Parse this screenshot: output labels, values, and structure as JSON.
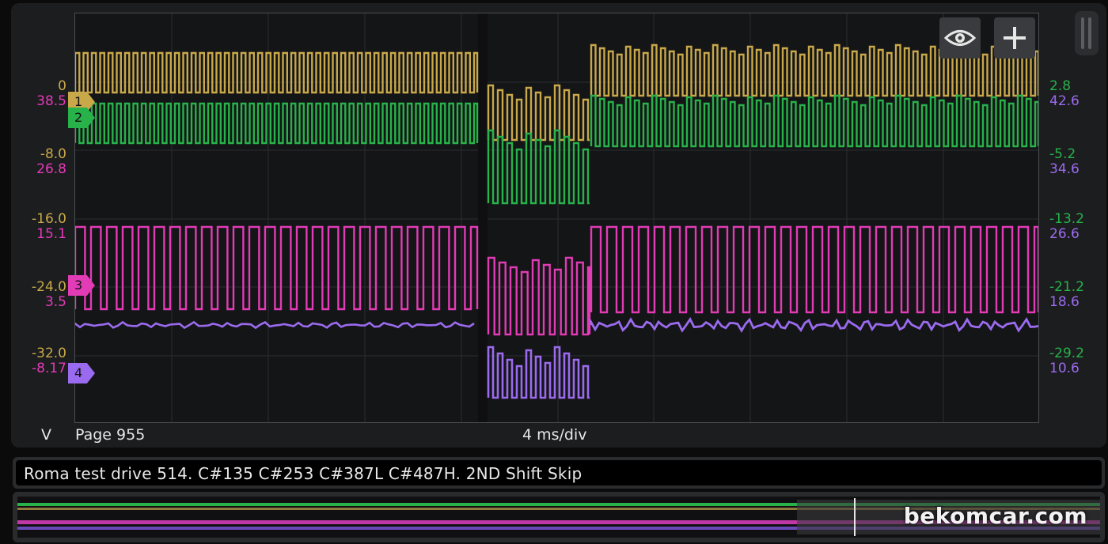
{
  "scope": {
    "channels": [
      {
        "id": "1",
        "color": "#c9a84a"
      },
      {
        "id": "2",
        "color": "#27b24a"
      },
      {
        "id": "3",
        "color": "#e23bb6"
      },
      {
        "id": "4",
        "color": "#9b6bef"
      }
    ],
    "left_scale": [
      {
        "a": "0",
        "b": "38.5"
      },
      {
        "a": "-8.0",
        "b": "26.8"
      },
      {
        "a": "-16.0",
        "b": "15.1"
      },
      {
        "a": "-24.0",
        "b": "3.5"
      },
      {
        "a": "-32.0",
        "b": "-8.17"
      }
    ],
    "right_scale": [
      {
        "a": "2.8",
        "b": "42.6"
      },
      {
        "a": "-5.2",
        "b": "34.6"
      },
      {
        "a": "-13.2",
        "b": "26.6"
      },
      {
        "a": "-21.2",
        "b": "18.6"
      },
      {
        "a": "-29.2",
        "b": "10.6"
      }
    ],
    "unit": "V",
    "page": "Page 955",
    "timebase": "4 ms/div"
  },
  "toolbar": {
    "eye_icon": "eye-icon",
    "add_icon": "plus-icon"
  },
  "caption": "Roma test drive 514. C#135 C#253 C#387L C#487H. 2ND Shift Skip",
  "watermark": "bekomcar.com",
  "colors": {
    "left_scale_a": "#c9a84a",
    "left_scale_b": "#e23bb6",
    "right_scale_a": "#27b24a",
    "right_scale_b": "#9b6bef"
  }
}
